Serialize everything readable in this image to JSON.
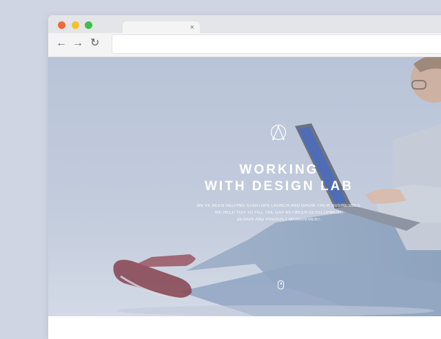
{
  "window": {
    "controls": [
      "close",
      "minimize",
      "maximize"
    ],
    "colors": {
      "close": "#f2673a",
      "minimize": "#f7c12d",
      "maximize": "#3cbf4b"
    }
  },
  "tab": {
    "close_symbol": "×"
  },
  "toolbar": {
    "back_symbol": "←",
    "forward_symbol": "→",
    "reload_symbol": "↻",
    "address_value": ""
  },
  "hero": {
    "title_line1": "WORKING",
    "title_line2": "WITH DESIGN LAB",
    "subtitle_line1": "WE'VE BEEN HELPING STARTUPS LAUNCH AND GROW THEIR BUSINESSES.",
    "subtitle_line2": "WE HELP YOU TO FILL THE GAP BETWEEN DEVELOPMENT,",
    "subtitle_line3": "DESIGN AND PRODUCT MANAGEMENT.",
    "logo_icon": "triangle-logo-icon",
    "scroll_icon": "mouse-scroll-icon"
  }
}
